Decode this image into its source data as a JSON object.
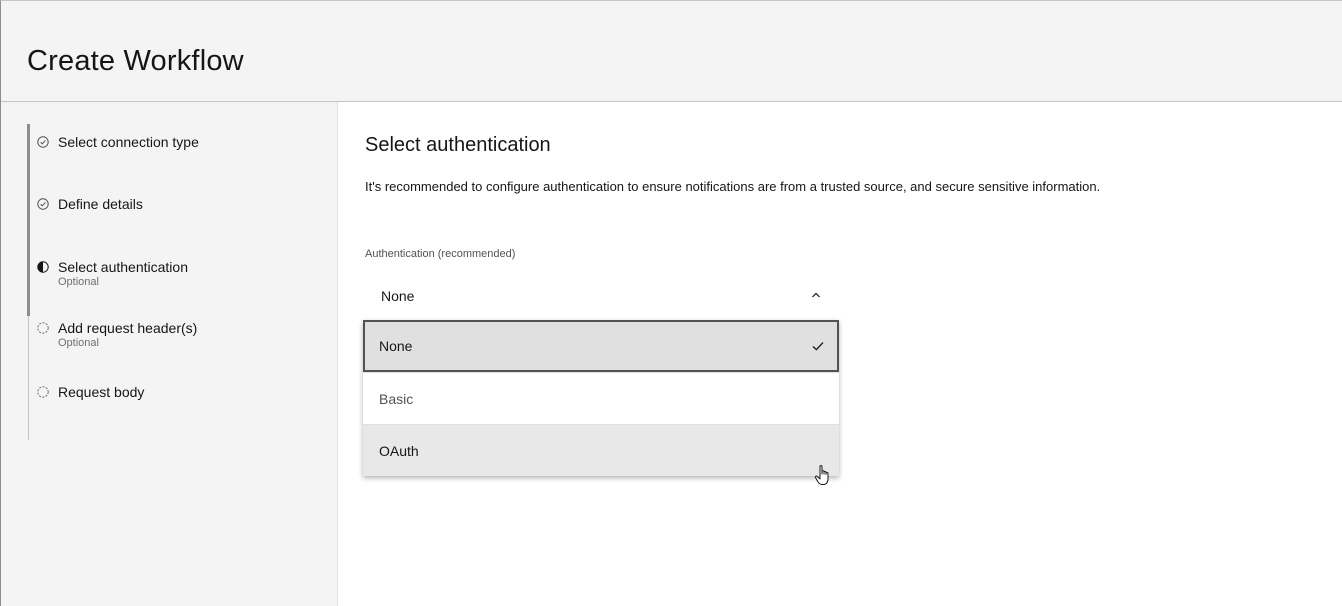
{
  "header": {
    "title": "Create Workflow"
  },
  "steps": [
    {
      "label": "Select connection type",
      "sub": "",
      "state": "complete",
      "icon": "check-circle-icon"
    },
    {
      "label": "Define details",
      "sub": "",
      "state": "complete",
      "icon": "check-circle-icon"
    },
    {
      "label": "Select authentication",
      "sub": "Optional",
      "state": "current",
      "icon": "half-circle-icon"
    },
    {
      "label": "Add request header(s)",
      "sub": "Optional",
      "state": "incomplete",
      "icon": "dashed-circle-icon"
    },
    {
      "label": "Request body",
      "sub": "",
      "state": "incomplete",
      "icon": "dashed-circle-icon"
    }
  ],
  "main": {
    "title": "Select authentication",
    "description": "It's recommended to configure authentication to ensure notifications are from a trusted source, and secure sensitive information.",
    "field": {
      "label": "Authentication (recommended)",
      "value": "None",
      "options": [
        {
          "label": "None",
          "selected": true
        },
        {
          "label": "Basic",
          "selected": false
        },
        {
          "label": "OAuth",
          "selected": false,
          "hovered": true
        }
      ]
    }
  },
  "colors": {
    "header_bg": "#f4f4f4",
    "sidebar_bg": "#f4f4f4",
    "selected_option_bg": "#e0e0e0",
    "hover_option_bg": "#e8e8e8",
    "text": "#161616",
    "muted_text": "#6f6f6f"
  }
}
